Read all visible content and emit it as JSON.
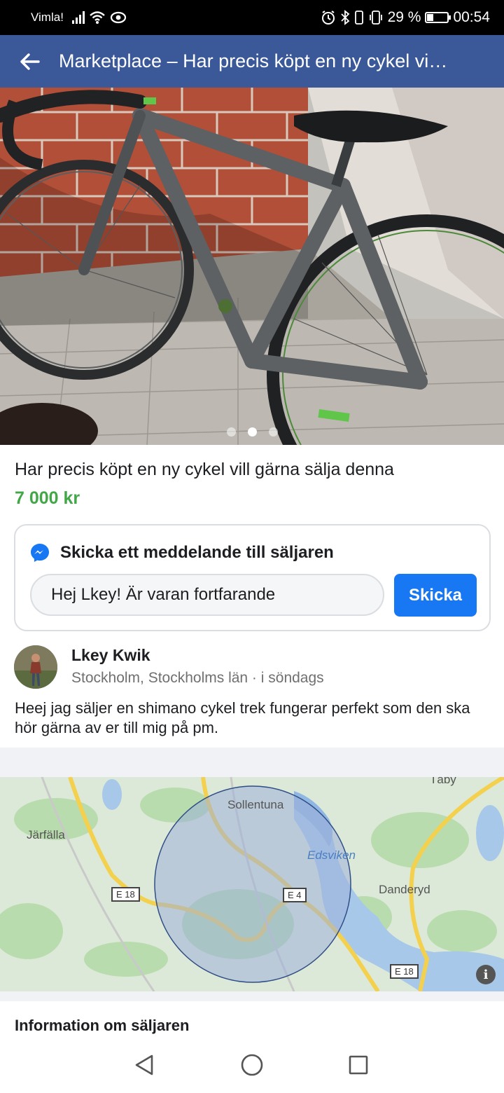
{
  "status_bar": {
    "carrier": "Vimla!",
    "battery_percent": "29 %",
    "battery_level": 0.29,
    "time": "00:54"
  },
  "app_bar": {
    "title": "Marketplace – Har precis köpt en ny cykel vi…",
    "back_icon": "arrow-left-icon"
  },
  "photo": {
    "page_count": 3,
    "active_index": 1
  },
  "listing": {
    "title": "Har precis köpt en ny cykel vill gärna sälja denna",
    "price": "7 000 kr"
  },
  "message_card": {
    "heading": "Skicka ett meddelande till säljaren",
    "input_value": "Hej Lkey! Är varan fortfarande",
    "send_label": "Skicka"
  },
  "seller": {
    "name": "Lkey Kwik",
    "location_time": "Stockholm, Stockholms län · i söndags"
  },
  "description": "Heej jag säljer en shimano cykel trek fungerar perfekt som den ska hör gärna av er  till mig på pm.",
  "map": {
    "labels": {
      "taby": "Täby",
      "sollentuna": "Sollentuna",
      "jarfalla": "Järfälla",
      "edsviken": "Edsviken",
      "danderyd": "Danderyd"
    },
    "roads": {
      "e18_west": "E 18",
      "e4": "E 4",
      "e18_east": "E 18"
    },
    "info_label": "i"
  },
  "seller_info_heading": "Information om säljaren",
  "colors": {
    "app_bar": "#3b5998",
    "price": "#42a747",
    "send_button": "#1877f2"
  }
}
